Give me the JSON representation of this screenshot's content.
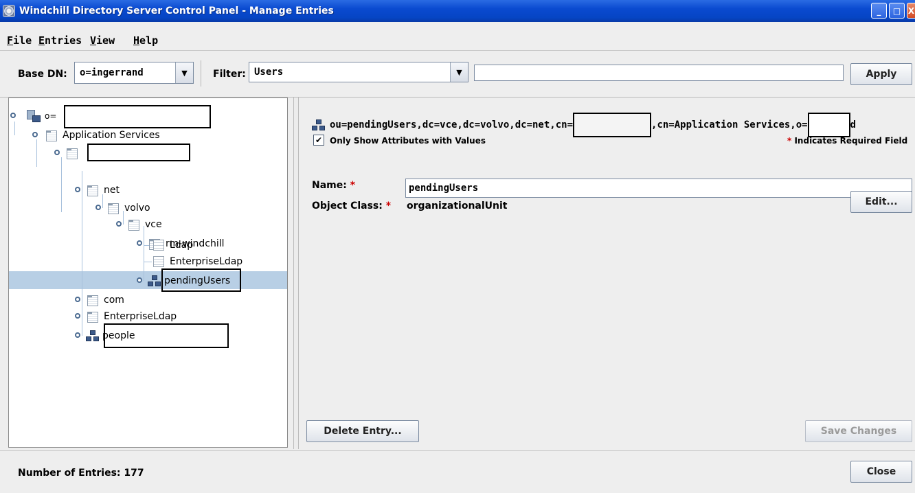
{
  "window": {
    "title": "Windchill Directory Server Control Panel - Manage Entries",
    "minimize": "_",
    "maximize": "□",
    "close": "X"
  },
  "menu": [
    {
      "mnemonic": "F",
      "rest": "ile"
    },
    {
      "mnemonic": "E",
      "rest": "ntries"
    },
    {
      "mnemonic": "V",
      "rest": "iew"
    },
    {
      "mnemonic": "H",
      "rest": "elp"
    }
  ],
  "toolbar": {
    "base_dn_label": "Base DN:",
    "base_dn_value": "o=ingerrand",
    "filter_label": "Filter:",
    "filter_value": "Users",
    "filter_text": "",
    "apply_label": "Apply"
  },
  "tree": {
    "root_prefix": "o=",
    "application_services": "Application Services",
    "net": "net",
    "volvo": "volvo",
    "vce": "vce",
    "rm_windchill": "rm-windchill",
    "ldap": "Ldap",
    "enterprise_ldap_child": "EnterpriseLdap",
    "pending_users": "pendingUsers",
    "com": "com",
    "enterprise_ldap": "EnterpriseLdap",
    "people": "people"
  },
  "details": {
    "dn_part1": "ou=pendingUsers,dc=vce,dc=volvo,dc=net,cn=",
    "dn_part2": ",cn=Application Services,o=",
    "dn_tail": "d",
    "only_show_label": "Only Show Attributes with Values",
    "only_show_checked": "✔",
    "required_note": "Indicates Required Field",
    "asterisk": "*",
    "name_label": "Name:",
    "name_value": "pendingUsers",
    "object_class_label": "Object Class:",
    "object_class_value": "organizationalUnit",
    "edit_label": "Edit...",
    "delete_label": "Delete Entry...",
    "save_label": "Save Changes"
  },
  "status": {
    "entries_text": "Number of Entries: 177",
    "close_label": "Close"
  },
  "colors": {
    "title_blue": "#0645c4",
    "selection": "#b8cfe5",
    "required_red": "#cc0000"
  }
}
